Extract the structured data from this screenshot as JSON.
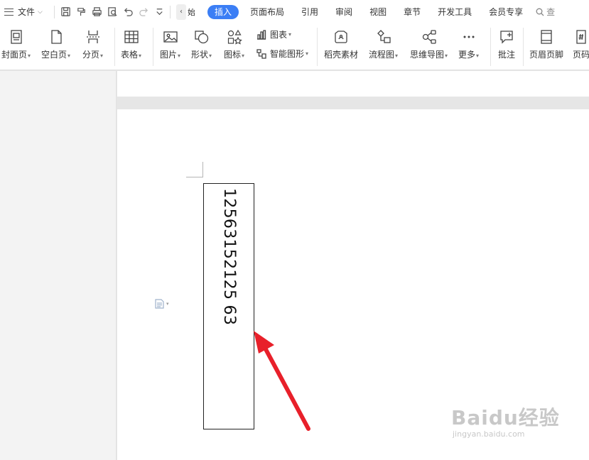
{
  "menubar": {
    "file_label": "文件",
    "tab_fragment": "始",
    "tabs": [
      {
        "label": "插入",
        "active": true
      },
      {
        "label": "页面布局"
      },
      {
        "label": "引用"
      },
      {
        "label": "审阅"
      },
      {
        "label": "视图"
      },
      {
        "label": "章节"
      },
      {
        "label": "开发工具"
      },
      {
        "label": "会员专享"
      }
    ],
    "search_label": "查"
  },
  "ribbon": {
    "cover_page": "封面页",
    "blank_page": "空白页",
    "page_break": "分页",
    "table": "表格",
    "picture": "图片",
    "shape": "形状",
    "icon": "图标",
    "chart": "图表",
    "smart_art": "智能图形",
    "docer_material": "稻壳素材",
    "flowchart": "流程图",
    "mind_map": "思维导图",
    "more": "更多",
    "comment": "批注",
    "header_footer": "页眉页脚",
    "page_number": "页码"
  },
  "document": {
    "textbox_text": "12563152125 63"
  },
  "watermark": {
    "line1": "Baidu经验",
    "line2": "jingyan.baidu.com"
  },
  "colors": {
    "accent": "#3b7ef5",
    "arrow": "#e8202a"
  }
}
